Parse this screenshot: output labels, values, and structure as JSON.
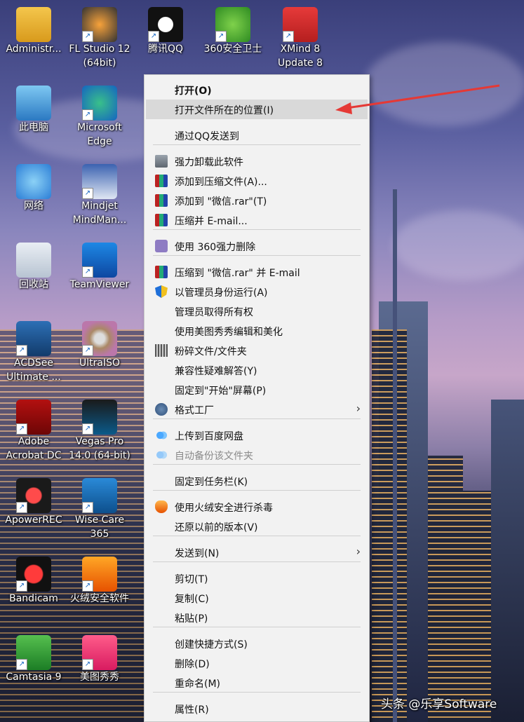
{
  "desktop": {
    "icons": [
      {
        "label": "Administr...",
        "icon": "user-folder-icon"
      },
      {
        "label": "FL Studio 12\n(64bit)",
        "icon": "fl-studio-icon"
      },
      {
        "label": "腾讯QQ",
        "icon": "qq-penguin-icon"
      },
      {
        "label": "360安全卫士",
        "icon": "360-security-icon"
      },
      {
        "label": "XMind 8\nUpdate 8",
        "icon": "xmind-icon"
      },
      {
        "label": "此电脑",
        "icon": "this-pc-icon"
      },
      {
        "label": "Microsoft\nEdge",
        "icon": "edge-icon"
      },
      {
        "label": "网络",
        "icon": "network-icon"
      },
      {
        "label": "Mindjet\nMindMan...",
        "icon": "mindjet-icon"
      },
      {
        "label": "回收站",
        "icon": "recycle-bin-icon"
      },
      {
        "label": "TeamViewer",
        "icon": "teamviewer-icon"
      },
      {
        "label": "ACDSee\nUltimate ...",
        "icon": "acdsee-icon"
      },
      {
        "label": "UltraISO",
        "icon": "ultraiso-disc-icon"
      },
      {
        "label": "Adobe\nAcrobat DC",
        "icon": "acrobat-icon"
      },
      {
        "label": "Vegas Pro\n14.0 (64-bit)",
        "icon": "vegas-icon"
      },
      {
        "label": "ApowerREC",
        "icon": "apowerrec-icon"
      },
      {
        "label": "Wise Care\n365",
        "icon": "wise-care-icon"
      },
      {
        "label": "Bandicam",
        "icon": "bandicam-icon"
      },
      {
        "label": "火绒安全软件",
        "icon": "huorong-icon"
      },
      {
        "label": "Camtasia 9",
        "icon": "camtasia-icon"
      },
      {
        "label": "美图秀秀",
        "icon": "meitu-icon"
      }
    ]
  },
  "context_menu": {
    "items": [
      {
        "label": "打开(O)",
        "icon": "",
        "bold": true
      },
      {
        "label": "打开文件所在的位置(I)",
        "icon": "",
        "highlighted": true
      },
      {
        "label": "通过QQ发送到",
        "icon": ""
      },
      {
        "label": "强力卸载此软件",
        "icon": "trash-can-icon"
      },
      {
        "label": "添加到压缩文件(A)...",
        "icon": "winrar-icon"
      },
      {
        "label": "添加到 \"微信.rar\"(T)",
        "icon": "winrar-icon"
      },
      {
        "label": "压缩并 E-mail...",
        "icon": "winrar-icon"
      },
      {
        "label": "使用 360强力删除",
        "icon": "360-shred-icon"
      },
      {
        "label": "压缩到 \"微信.rar\" 并 E-mail",
        "icon": "winrar-icon"
      },
      {
        "label": "以管理员身份运行(A)",
        "icon": "uac-shield-icon"
      },
      {
        "label": "管理员取得所有权",
        "icon": ""
      },
      {
        "label": "使用美图秀秀编辑和美化",
        "icon": ""
      },
      {
        "label": "粉碎文件/文件夹",
        "icon": "shredder-icon"
      },
      {
        "label": "兼容性疑难解答(Y)",
        "icon": ""
      },
      {
        "label": "固定到\"开始\"屏幕(P)",
        "icon": ""
      },
      {
        "label": "格式工厂",
        "icon": "format-factory-icon",
        "submenu": true
      },
      {
        "label": "上传到百度网盘",
        "icon": "baidu-netdisk-icon"
      },
      {
        "label": "自动备份该文件夹",
        "icon": "baidu-netdisk-icon",
        "disabled": true
      },
      {
        "label": "固定到任务栏(K)",
        "icon": ""
      },
      {
        "label": "使用火绒安全进行杀毒",
        "icon": "huorong-icon"
      },
      {
        "label": "还原以前的版本(V)",
        "icon": ""
      },
      {
        "label": "发送到(N)",
        "icon": "",
        "submenu": true
      },
      {
        "label": "剪切(T)",
        "icon": ""
      },
      {
        "label": "复制(C)",
        "icon": ""
      },
      {
        "label": "粘贴(P)",
        "icon": ""
      },
      {
        "label": "创建快捷方式(S)",
        "icon": ""
      },
      {
        "label": "删除(D)",
        "icon": ""
      },
      {
        "label": "重命名(M)",
        "icon": ""
      },
      {
        "label": "属性(R)",
        "icon": ""
      }
    ]
  },
  "watermark": "头条 @乐享Software",
  "colors": {
    "arrow": "#e53935",
    "highlight": "#d9d9d9",
    "menu_bg": "#f2f2f2"
  }
}
